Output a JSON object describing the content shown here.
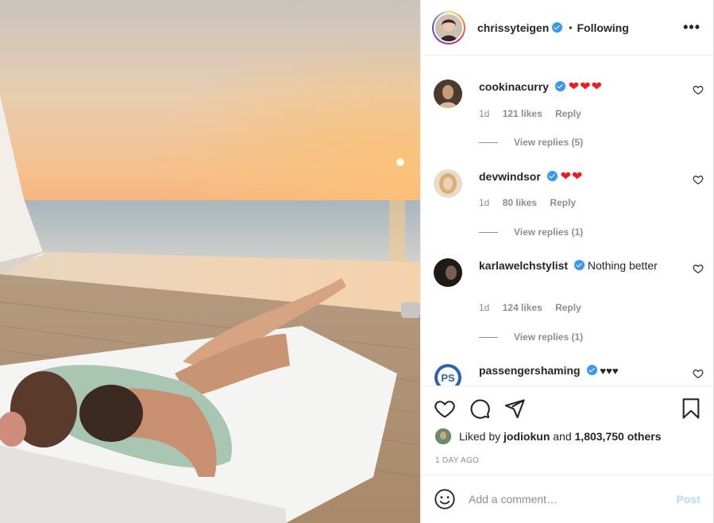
{
  "post": {
    "username": "chrissyteigen",
    "separator": "•",
    "follow_status": "Following",
    "more_label": "•••"
  },
  "comments": [
    {
      "username": "cookinacurry",
      "text": "",
      "emoji": "❤❤❤",
      "emoji_style": "red",
      "time": "1d",
      "likes": "121 likes",
      "reply": "Reply",
      "view_replies": "View replies (5)"
    },
    {
      "username": "devwindsor",
      "text": "",
      "emoji": "❤❤",
      "emoji_style": "red",
      "time": "1d",
      "likes": "80 likes",
      "reply": "Reply",
      "view_replies": "View replies (1)"
    },
    {
      "username": "karlawelchstylist",
      "text": "Nothing better",
      "emoji": "",
      "emoji_style": "",
      "time": "1d",
      "likes": "124 likes",
      "reply": "Reply",
      "view_replies": "View replies (1)"
    },
    {
      "username": "passengershaming",
      "text": "",
      "emoji": "♥♥♥",
      "emoji_style": "black",
      "time": "",
      "likes": "",
      "reply": "",
      "view_replies": ""
    }
  ],
  "likes": {
    "prefix": "Liked by",
    "user": "jodiokun",
    "conj": "and",
    "count": "1,803,750 others"
  },
  "timestamp": "1 DAY AGO",
  "add_comment": {
    "placeholder": "Add a comment…",
    "post_label": "Post"
  },
  "colors": {
    "verified": "#3897f0",
    "heart": "#ed1c24",
    "post_disabled": "#b3dbff",
    "muted_text": "#8e8e8e"
  },
  "icons": [
    "heart-icon",
    "comment-icon",
    "share-icon",
    "bookmark-icon",
    "smile-icon",
    "verified-icon",
    "more-icon"
  ]
}
